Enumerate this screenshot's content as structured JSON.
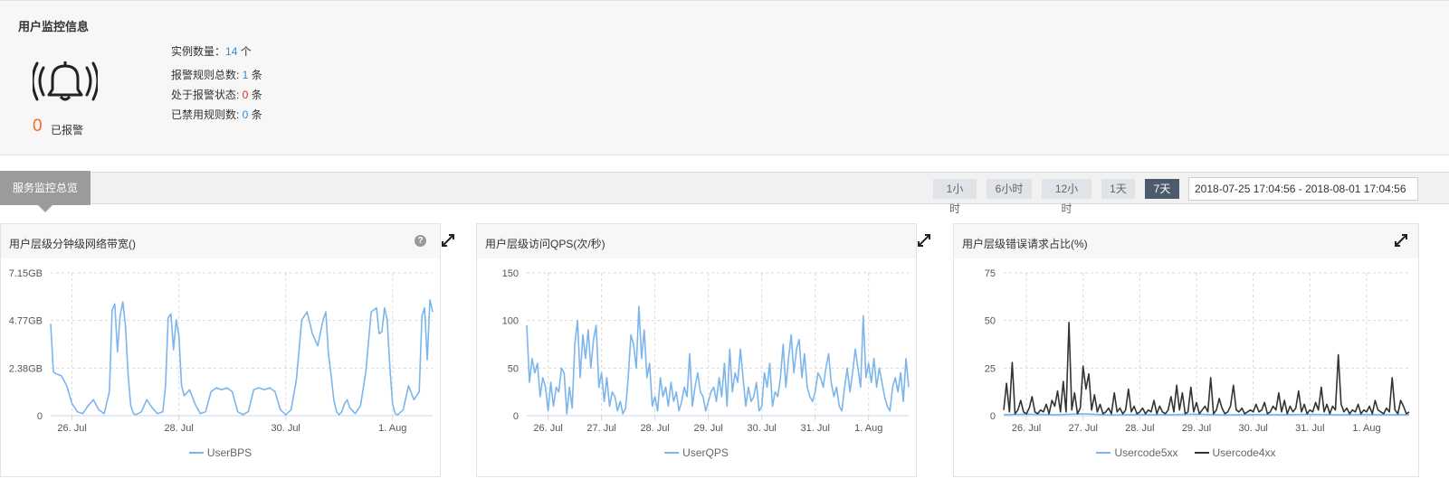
{
  "user_monitor": {
    "title": "用户监控信息",
    "alarm_count": "0",
    "alarm_label": "已报警",
    "stats": [
      {
        "label": "实例数量：",
        "value": "14",
        "unit": " 个",
        "color": "#2e8ed6"
      },
      {
        "label": "报警规则总数: ",
        "value": "1",
        "unit": " 条",
        "color": "#2e8ed6"
      },
      {
        "label": "处于报警状态: ",
        "value": "0",
        "unit": " 条",
        "color": "#e2241b"
      },
      {
        "label": "已禁用规则数: ",
        "value": "0",
        "unit": " 条",
        "color": "#2e8ed6"
      }
    ]
  },
  "overview": {
    "tab_label": "服务监控总览",
    "ranges": [
      "1小时",
      "6小时",
      "12小时",
      "1天",
      "7天"
    ],
    "active_range": "7天",
    "date_range": "2018-07-25 17:04:56 - 2018-08-01 17:04:56"
  },
  "cards": [
    {
      "title": "用户层级分钟级网络带宽()",
      "has_help": true,
      "help_glyph": "?"
    },
    {
      "title": "用户层级访问QPS(次/秒)",
      "has_help": false
    },
    {
      "title": "用户层级错误请求占比(%)",
      "has_help": false
    }
  ],
  "colors": {
    "blue_series": "#7cb5ec",
    "dark_series": "#333333",
    "grid": "#d9d9d9",
    "axis": "#ccd6eb"
  },
  "chart_data": [
    {
      "type": "line",
      "title": "用户层级分钟级网络带宽()",
      "y_ticks": [
        "0",
        "2.38GB",
        "4.77GB",
        "7.15GB"
      ],
      "ylim": [
        0,
        7.15
      ],
      "x_ticks": [
        "26. Jul",
        "28. Jul",
        "30. Jul",
        "1. Aug"
      ],
      "x_tick_days": [
        1,
        3,
        5,
        7
      ],
      "xlim_days": [
        0.6,
        7.75
      ],
      "series": [
        {
          "name": "UserBPS",
          "color": "#7cb5ec",
          "x_days": [
            0.6,
            0.65,
            0.7,
            0.8,
            0.9,
            1.0,
            1.1,
            1.2,
            1.3,
            1.4,
            1.5,
            1.6,
            1.7,
            1.75,
            1.8,
            1.85,
            1.9,
            1.95,
            2.0,
            2.05,
            2.1,
            2.15,
            2.2,
            2.3,
            2.4,
            2.5,
            2.6,
            2.7,
            2.75,
            2.8,
            2.85,
            2.9,
            2.95,
            3.0,
            3.05,
            3.1,
            3.2,
            3.3,
            3.4,
            3.5,
            3.6,
            3.7,
            3.8,
            3.9,
            4.0,
            4.1,
            4.2,
            4.3,
            4.4,
            4.5,
            4.6,
            4.7,
            4.8,
            4.9,
            5.0,
            5.1,
            5.2,
            5.3,
            5.4,
            5.5,
            5.6,
            5.7,
            5.75,
            5.8,
            5.85,
            5.9,
            5.95,
            6.0,
            6.05,
            6.1,
            6.15,
            6.2,
            6.3,
            6.4,
            6.5,
            6.6,
            6.7,
            6.75,
            6.8,
            6.85,
            6.9,
            6.95,
            7.0,
            7.05,
            7.1,
            7.2,
            7.3,
            7.4,
            7.5,
            7.55,
            7.6,
            7.65,
            7.7,
            7.75
          ],
          "y": [
            4.6,
            2.2,
            2.1,
            2.0,
            1.5,
            0.6,
            0.2,
            0.1,
            0.5,
            0.8,
            0.3,
            0.1,
            1.2,
            5.3,
            5.6,
            3.2,
            5.0,
            5.7,
            4.5,
            2.0,
            0.5,
            0.1,
            0.05,
            0.2,
            0.8,
            0.4,
            0.1,
            0.2,
            1.5,
            4.9,
            5.1,
            3.3,
            4.8,
            4.0,
            1.5,
            1.0,
            1.3,
            0.6,
            0.1,
            0.2,
            1.2,
            1.4,
            1.3,
            1.4,
            1.2,
            0.2,
            0.05,
            0.2,
            1.3,
            1.4,
            1.3,
            1.4,
            1.2,
            0.3,
            0.05,
            0.3,
            1.8,
            4.8,
            5.2,
            4.1,
            3.5,
            4.8,
            5.2,
            3.1,
            2.0,
            0.8,
            0.2,
            0.05,
            0.2,
            0.6,
            0.8,
            0.4,
            0.1,
            0.5,
            2.2,
            5.2,
            5.4,
            4.1,
            4.2,
            5.4,
            4.8,
            2.4,
            0.6,
            0.1,
            0.05,
            0.3,
            1.5,
            0.8,
            1.2,
            5.0,
            5.4,
            2.8,
            5.8,
            5.2
          ]
        }
      ]
    },
    {
      "type": "line",
      "title": "用户层级访问QPS(次/秒)",
      "y_ticks": [
        "0",
        "50",
        "100",
        "150"
      ],
      "ylim": [
        0,
        150
      ],
      "x_ticks": [
        "26. Jul",
        "27. Jul",
        "28. Jul",
        "29. Jul",
        "30. Jul",
        "31. Jul",
        "1. Aug"
      ],
      "x_tick_days": [
        1,
        2,
        3,
        4,
        5,
        6,
        7
      ],
      "xlim_days": [
        0.6,
        7.75
      ],
      "series": [
        {
          "name": "UserQPS",
          "color": "#7cb5ec",
          "x_days": [
            0.6,
            0.65,
            0.7,
            0.75,
            0.8,
            0.85,
            0.9,
            0.95,
            1.0,
            1.05,
            1.1,
            1.15,
            1.2,
            1.25,
            1.3,
            1.35,
            1.4,
            1.45,
            1.5,
            1.55,
            1.6,
            1.65,
            1.7,
            1.75,
            1.8,
            1.85,
            1.9,
            1.95,
            2.0,
            2.05,
            2.1,
            2.15,
            2.2,
            2.25,
            2.3,
            2.35,
            2.4,
            2.45,
            2.5,
            2.55,
            2.6,
            2.65,
            2.7,
            2.75,
            2.8,
            2.85,
            2.9,
            2.95,
            3.0,
            3.05,
            3.1,
            3.15,
            3.2,
            3.25,
            3.3,
            3.35,
            3.4,
            3.45,
            3.5,
            3.55,
            3.6,
            3.65,
            3.7,
            3.75,
            3.8,
            3.85,
            3.9,
            3.95,
            4.0,
            4.05,
            4.1,
            4.15,
            4.2,
            4.25,
            4.3,
            4.35,
            4.4,
            4.45,
            4.5,
            4.55,
            4.6,
            4.65,
            4.7,
            4.75,
            4.8,
            4.85,
            4.9,
            4.95,
            5.0,
            5.05,
            5.1,
            5.15,
            5.2,
            5.25,
            5.3,
            5.35,
            5.4,
            5.45,
            5.5,
            5.55,
            5.6,
            5.65,
            5.7,
            5.75,
            5.8,
            5.85,
            5.9,
            5.95,
            6.0,
            6.05,
            6.1,
            6.15,
            6.2,
            6.25,
            6.3,
            6.35,
            6.4,
            6.45,
            6.5,
            6.55,
            6.6,
            6.65,
            6.7,
            6.75,
            6.8,
            6.85,
            6.9,
            6.95,
            7.0,
            7.05,
            7.1,
            7.15,
            7.2,
            7.25,
            7.3,
            7.35,
            7.4,
            7.45,
            7.5,
            7.55,
            7.6,
            7.65,
            7.7,
            7.75
          ],
          "y": [
            95,
            35,
            60,
            45,
            55,
            20,
            40,
            30,
            5,
            35,
            10,
            30,
            25,
            50,
            45,
            2,
            30,
            8,
            75,
            100,
            40,
            85,
            60,
            90,
            50,
            80,
            95,
            30,
            45,
            15,
            40,
            10,
            25,
            20,
            5,
            15,
            2,
            8,
            40,
            85,
            75,
            50,
            115,
            60,
            90,
            40,
            55,
            10,
            20,
            5,
            40,
            20,
            30,
            10,
            35,
            15,
            25,
            5,
            15,
            30,
            20,
            65,
            10,
            30,
            45,
            25,
            20,
            5,
            15,
            25,
            30,
            15,
            40,
            20,
            55,
            10,
            70,
            25,
            45,
            35,
            70,
            40,
            10,
            30,
            15,
            20,
            35,
            5,
            10,
            45,
            30,
            55,
            10,
            25,
            20,
            40,
            75,
            30,
            60,
            85,
            45,
            70,
            80,
            40,
            65,
            30,
            20,
            15,
            25,
            45,
            40,
            30,
            50,
            65,
            35,
            20,
            30,
            10,
            5,
            30,
            50,
            25,
            45,
            70,
            50,
            30,
            105,
            40,
            55,
            35,
            60,
            30,
            50,
            35,
            20,
            10,
            5,
            30,
            40,
            25,
            45,
            15,
            60,
            30,
            65,
            20,
            40,
            50,
            30,
            50
          ]
        }
      ]
    },
    {
      "type": "line",
      "title": "用户层级错误请求占比(%)",
      "y_ticks": [
        "0",
        "25",
        "50",
        "75"
      ],
      "ylim": [
        0,
        75
      ],
      "x_ticks": [
        "26. Jul",
        "27. Jul",
        "28. Jul",
        "29. Jul",
        "30. Jul",
        "31. Jul",
        "1. Aug"
      ],
      "x_tick_days": [
        1,
        2,
        3,
        4,
        5,
        6,
        7
      ],
      "xlim_days": [
        0.6,
        7.75
      ],
      "series": [
        {
          "name": "Usercode5xx",
          "color": "#7cb5ec",
          "x_days": [
            0.6,
            1.0,
            1.5,
            2.0,
            2.5,
            3.0,
            3.5,
            4.0,
            4.5,
            5.0,
            5.5,
            6.0,
            6.5,
            7.0,
            7.5,
            7.75
          ],
          "y": [
            0.5,
            0.8,
            0.5,
            1.0,
            0.4,
            0.6,
            0.5,
            0.8,
            0.4,
            0.6,
            0.5,
            0.7,
            0.5,
            0.6,
            0.5,
            0.6
          ]
        },
        {
          "name": "Usercode4xx",
          "color": "#333333",
          "x_days": [
            0.6,
            0.65,
            0.7,
            0.75,
            0.8,
            0.85,
            0.9,
            0.95,
            1.0,
            1.05,
            1.1,
            1.15,
            1.2,
            1.25,
            1.3,
            1.35,
            1.4,
            1.45,
            1.5,
            1.55,
            1.6,
            1.65,
            1.7,
            1.75,
            1.8,
            1.85,
            1.9,
            1.95,
            2.0,
            2.05,
            2.1,
            2.15,
            2.2,
            2.25,
            2.3,
            2.35,
            2.4,
            2.45,
            2.5,
            2.55,
            2.6,
            2.65,
            2.7,
            2.75,
            2.8,
            2.85,
            2.9,
            2.95,
            3.0,
            3.05,
            3.1,
            3.15,
            3.2,
            3.25,
            3.3,
            3.35,
            3.4,
            3.45,
            3.5,
            3.55,
            3.6,
            3.65,
            3.7,
            3.75,
            3.8,
            3.85,
            3.9,
            3.95,
            4.0,
            4.05,
            4.1,
            4.15,
            4.2,
            4.25,
            4.3,
            4.35,
            4.4,
            4.45,
            4.5,
            4.55,
            4.6,
            4.65,
            4.7,
            4.75,
            4.8,
            4.85,
            4.9,
            4.95,
            5.0,
            5.05,
            5.1,
            5.15,
            5.2,
            5.25,
            5.3,
            5.35,
            5.4,
            5.45,
            5.5,
            5.55,
            5.6,
            5.65,
            5.7,
            5.75,
            5.8,
            5.85,
            5.9,
            5.95,
            6.0,
            6.05,
            6.1,
            6.15,
            6.2,
            6.25,
            6.3,
            6.35,
            6.4,
            6.45,
            6.5,
            6.55,
            6.6,
            6.65,
            6.7,
            6.75,
            6.8,
            6.85,
            6.9,
            6.95,
            7.0,
            7.05,
            7.1,
            7.15,
            7.2,
            7.25,
            7.3,
            7.35,
            7.4,
            7.45,
            7.5,
            7.55,
            7.6,
            7.65,
            7.7,
            7.75
          ],
          "y": [
            3,
            17,
            2,
            28,
            1,
            3,
            8,
            2,
            1,
            4,
            10,
            2,
            1,
            3,
            2,
            6,
            1,
            8,
            5,
            13,
            2,
            18,
            2,
            49,
            3,
            12,
            1,
            4,
            26,
            14,
            22,
            3,
            11,
            2,
            6,
            1,
            2,
            4,
            1,
            12,
            2,
            4,
            1,
            3,
            14,
            2,
            5,
            1,
            2,
            4,
            1,
            3,
            2,
            8,
            1,
            5,
            2,
            1,
            3,
            10,
            2,
            16,
            3,
            12,
            1,
            2,
            15,
            2,
            7,
            1,
            3,
            5,
            2,
            20,
            1,
            3,
            9,
            4,
            1,
            2,
            5,
            16,
            3,
            2,
            4,
            1,
            2,
            3,
            2,
            6,
            2,
            3,
            7,
            1,
            2,
            5,
            3,
            12,
            2,
            8,
            1,
            5,
            2,
            4,
            13,
            2,
            6,
            1,
            3,
            2,
            7,
            3,
            15,
            2,
            6,
            1,
            5,
            3,
            32,
            6,
            2,
            4,
            1,
            3,
            2,
            6,
            1,
            3,
            2,
            5,
            1,
            8,
            3,
            2,
            1,
            4,
            2,
            20,
            3,
            1,
            8,
            5,
            1,
            2
          ]
        }
      ]
    }
  ]
}
